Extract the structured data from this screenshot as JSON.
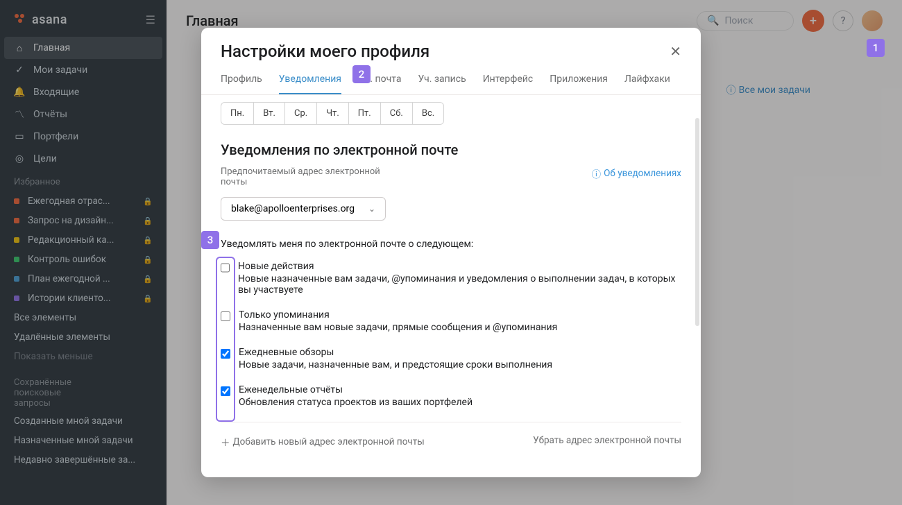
{
  "brand": "asana",
  "page_title": "Главная",
  "search_placeholder": "Поиск",
  "tasks_link": "Все мои задачи",
  "nav": {
    "home": "Главная",
    "my_tasks": "Мои задачи",
    "inbox": "Входящие",
    "reports": "Отчёты",
    "portfolios": "Портфели",
    "goals": "Цели"
  },
  "favorites_title": "Избранное",
  "favorites": [
    {
      "label": "Ежегодная отрас...",
      "color": "#f1683c"
    },
    {
      "label": "Запрос на дизайн...",
      "color": "#f1683c"
    },
    {
      "label": "Редакционный ка...",
      "color": "#f1c40f"
    },
    {
      "label": "Контроль ошибок",
      "color": "#3ac96e"
    },
    {
      "label": "План ежегодной ...",
      "color": "#4aa0d8"
    },
    {
      "label": "Истории клиенто...",
      "color": "#8f71e8"
    }
  ],
  "all_items": "Все элементы",
  "deleted_items": "Удалённые элементы",
  "show_less": "Показать меньше",
  "saved_searches_title": "Сохранённые поисковые запросы",
  "links": {
    "created": "Созданные мной задачи",
    "assigned": "Назначенные мной задачи",
    "recent": "Недавно завершённые за..."
  },
  "modal": {
    "title": "Настройки моего профиля",
    "tabs": {
      "profile": "Профиль",
      "notifications": "Уведомления",
      "email": "Эл. почта",
      "account": "Уч. запись",
      "display": "Интерфейс",
      "apps": "Приложения",
      "hacks": "Лайфхаки"
    },
    "days": [
      "Пн.",
      "Вт.",
      "Ср.",
      "Чт.",
      "Пт.",
      "Сб.",
      "Вс."
    ],
    "email_heading": "Уведомления по электронной почте",
    "pref_label": "Предпочитаемый адрес электронной почты",
    "about_link": "Об уведомлениях",
    "email_value": "blake@apolloenterprises.org",
    "notify_label": "Уведомлять меня по электронной почте о следующем:",
    "options": [
      {
        "title": "Новые действия",
        "desc": "Новые назначенные вам задачи, @упоминания и уведомления о выполнении задач, в которых вы участвуете",
        "checked": false
      },
      {
        "title": "Только упоминания",
        "desc": "Назначенные вам новые задачи, прямые сообщения и @упоминания",
        "checked": false
      },
      {
        "title": "Ежедневные обзоры",
        "desc": "Новые задачи, назначенные вам, и предстоящие сроки выполнения",
        "checked": true
      },
      {
        "title": "Еженедельные отчёты",
        "desc": "Обновления статуса проектов из ваших портфелей",
        "checked": true
      }
    ],
    "add_email": "Добавить новый адрес электронной почты",
    "remove_email": "Убрать адрес электронной почты"
  }
}
